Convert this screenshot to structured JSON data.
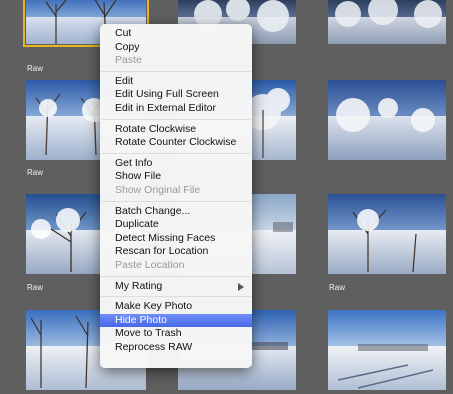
{
  "captions": [
    "Raw",
    "Raw",
    "Raw",
    "Raw"
  ],
  "menu": {
    "groups": [
      [
        {
          "label": "Cut"
        },
        {
          "label": "Copy"
        },
        {
          "label": "Paste",
          "disabled": true
        }
      ],
      [
        {
          "label": "Edit"
        },
        {
          "label": "Edit Using Full Screen"
        },
        {
          "label": "Edit in External Editor"
        }
      ],
      [
        {
          "label": "Rotate Clockwise"
        },
        {
          "label": "Rotate Counter Clockwise"
        }
      ],
      [
        {
          "label": "Get Info"
        },
        {
          "label": "Show File"
        },
        {
          "label": "Show Original File",
          "disabled": true
        }
      ],
      [
        {
          "label": "Batch Change..."
        },
        {
          "label": "Duplicate"
        },
        {
          "label": "Detect Missing Faces"
        },
        {
          "label": "Rescan for Location"
        },
        {
          "label": "Paste Location",
          "disabled": true
        }
      ],
      [
        {
          "label": "My Rating",
          "submenu": true
        }
      ],
      [
        {
          "label": "Make Key Photo"
        },
        {
          "label": "Hide Photo",
          "highlighted": true
        },
        {
          "label": "Move to Trash"
        },
        {
          "label": "Reprocess RAW"
        }
      ]
    ]
  },
  "colors": {
    "background": "#5f5f5f",
    "selection_outline": "#e8b422",
    "highlight": "#4768e8"
  }
}
